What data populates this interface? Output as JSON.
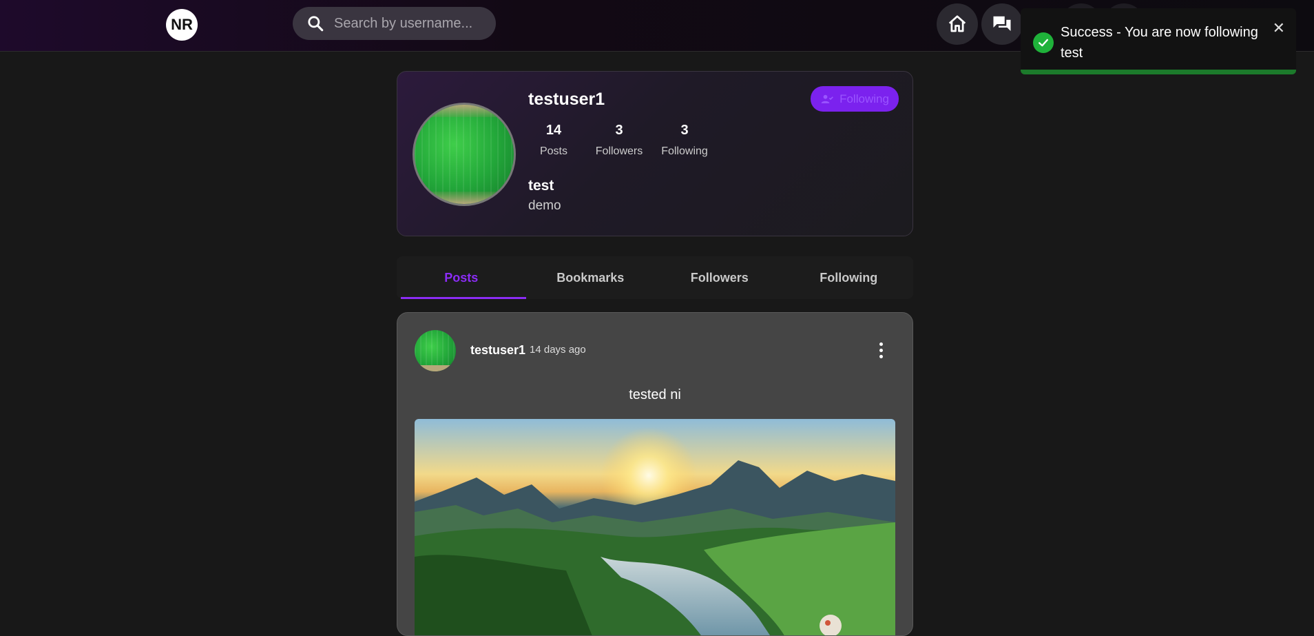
{
  "topbar": {
    "logo_text": "NR",
    "search_placeholder": "Search by username..."
  },
  "toast": {
    "message": "Success - You are now following test",
    "close_label": "✕",
    "accent_color": "#1fb23a"
  },
  "profile": {
    "username": "testuser1",
    "stats": [
      {
        "value": "14",
        "label": "Posts"
      },
      {
        "value": "3",
        "label": "Followers"
      },
      {
        "value": "3",
        "label": "Following"
      }
    ],
    "name": "test",
    "bio": "demo",
    "follow_button_label": "Following",
    "accent_color": "#8b2cf5"
  },
  "tabs": [
    {
      "label": "Posts",
      "active": true
    },
    {
      "label": "Bookmarks",
      "active": false
    },
    {
      "label": "Followers",
      "active": false
    },
    {
      "label": "Following",
      "active": false
    }
  ],
  "post": {
    "username": "testuser1",
    "time": "14 days ago",
    "text": "tested ni"
  }
}
